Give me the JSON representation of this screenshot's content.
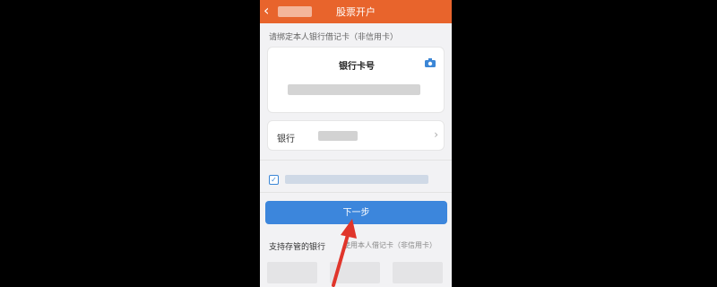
{
  "header": {
    "title": "股票开户",
    "back_icon": "chevron-left-icon"
  },
  "form": {
    "hint": "请绑定本人银行借记卡（非信用卡）",
    "card_number_title": "银行卡号",
    "bank_label": "银行",
    "next_label": "下一步",
    "support_label": "支持存管的银行",
    "support_note": "使用本人借记卡（非信用卡）"
  },
  "colors": {
    "header_bg": "#e8642c",
    "accent": "#3c86dc",
    "annotation_arrow": "#e0352b"
  }
}
